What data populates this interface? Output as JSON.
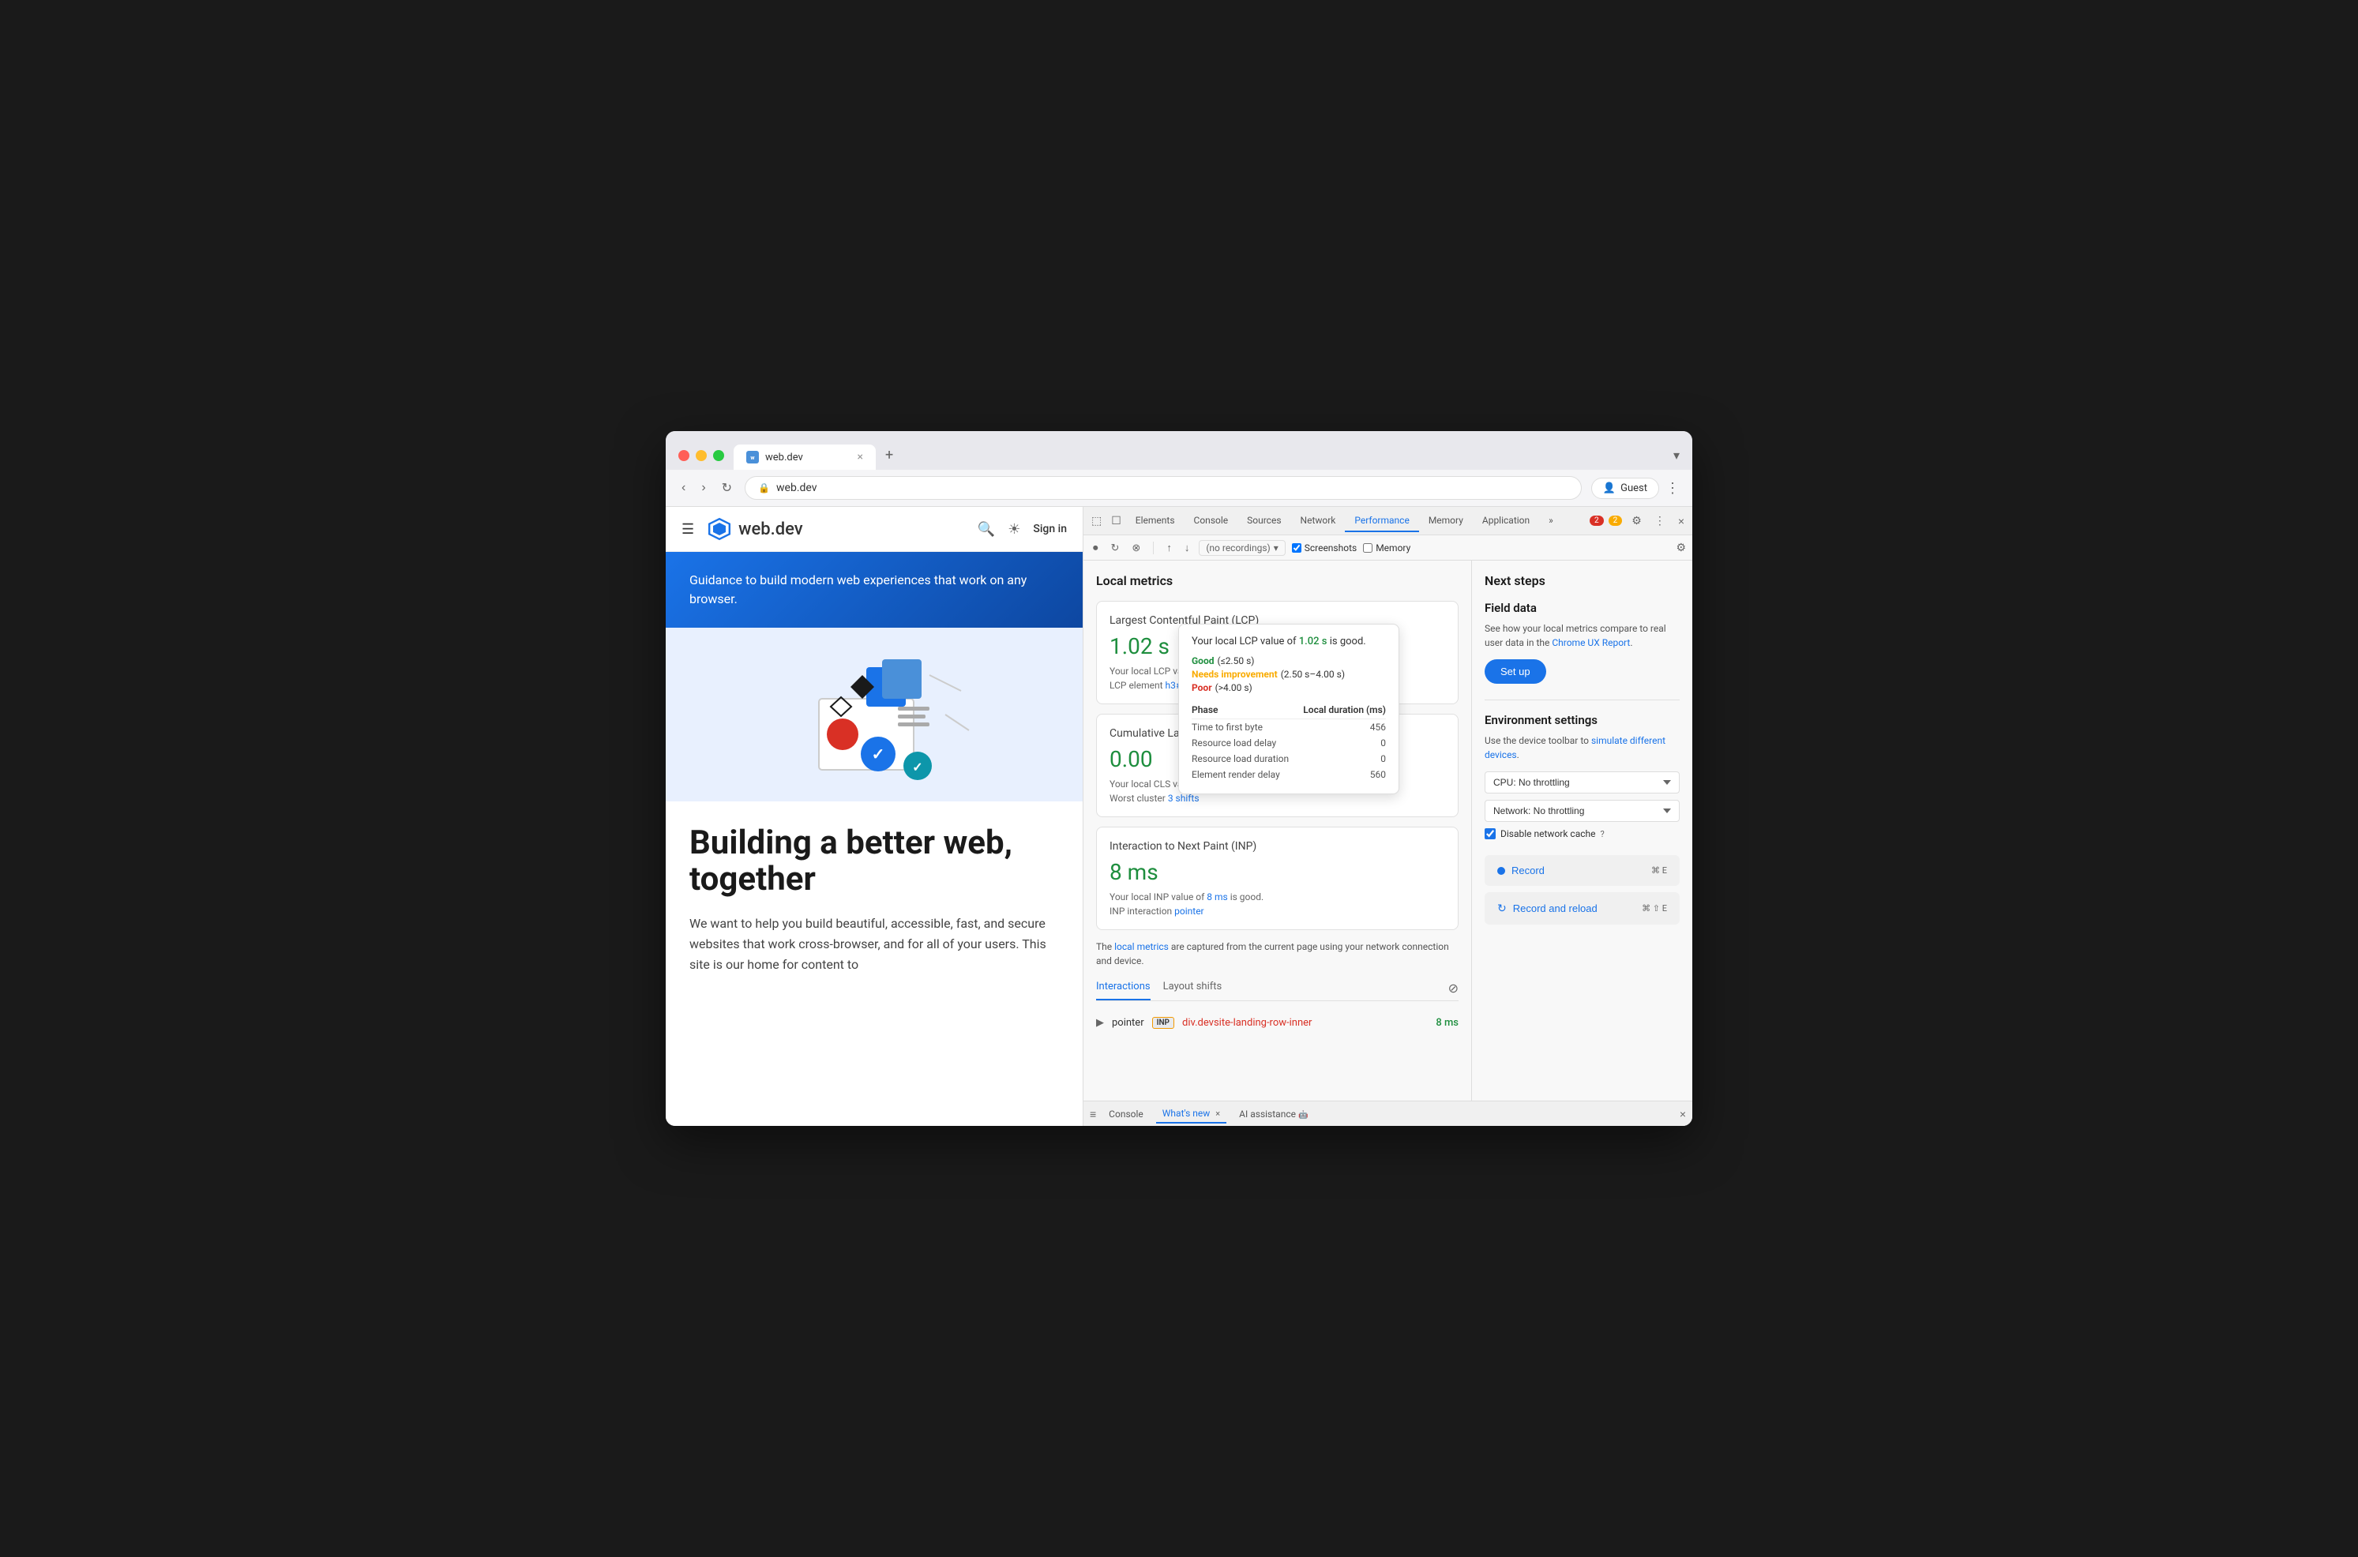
{
  "browser": {
    "traffic_lights": [
      "red",
      "yellow",
      "green"
    ],
    "tab_favicon": "web-dev-icon",
    "tab_title": "web.dev",
    "tab_close": "×",
    "tab_new": "+",
    "tab_menu_label": "▾",
    "address": "web.dev",
    "address_icon": "🔒",
    "guest_label": "Guest",
    "menu_icon": "⋮"
  },
  "webpage": {
    "hamburger": "☰",
    "logo_text": "web.dev",
    "search_icon": "search",
    "theme_icon": "theme",
    "signin_label": "Sign in",
    "hero_text": "Guidance to build modern web experiences that work on any browser.",
    "headline": "Building a better web, together",
    "subtext": "We want to help you build beautiful, accessible, fast, and secure websites that work cross-browser, and for all of your users. This site is our home for content to"
  },
  "devtools": {
    "tabs": [
      {
        "label": "Elements",
        "active": false
      },
      {
        "label": "Console",
        "active": false
      },
      {
        "label": "Sources",
        "active": false
      },
      {
        "label": "Network",
        "active": false
      },
      {
        "label": "Performance",
        "active": true
      },
      {
        "label": "Memory",
        "active": false
      },
      {
        "label": "Application",
        "active": false
      }
    ],
    "more_tabs": "»",
    "error_badge": "2",
    "warning_badge": "2",
    "close_icon": "×",
    "settings_icon": "⚙",
    "more_icon": "⋮",
    "toolbar": {
      "record_icon": "⏺",
      "reload_icon": "↻",
      "clear_icon": "⊗",
      "upload_icon": "↑",
      "download_icon": "↓",
      "recording_placeholder": "(no recordings)",
      "dropdown_icon": "▾",
      "screenshot_label": "Screenshots",
      "memory_label": "Memory",
      "settings_icon": "⚙"
    },
    "section_title": "Local metrics",
    "metrics": [
      {
        "name": "Largest Contentful Paint (LCP)",
        "value": "1.02 s",
        "value_class": "good",
        "desc": "Your local LCP value of",
        "highlight": "1.02 s",
        "desc2": "is good.",
        "element_label": "LCP element",
        "element_value": "h3#"
      },
      {
        "name": "Cumulative Layout Shift (CLS)",
        "value": "0.00",
        "value_class": "zero",
        "desc": "Your local CLS value",
        "worst_label": "Worst cluster",
        "worst_link": "3 shifts"
      },
      {
        "name": "Interaction to Next Paint (INP)",
        "value": "8 ms",
        "value_class": "good",
        "desc": "Your local INP value of",
        "highlight": "8 ms",
        "desc2": "is good.",
        "interaction_label": "INP interaction",
        "interaction_link": "pointer"
      }
    ],
    "local_metrics_note": "The local metrics are captured from the current page using your network connection and device.",
    "local_metrics_link": "local metrics",
    "interactions_tabs": [
      {
        "label": "Interactions",
        "active": true
      },
      {
        "label": "Layout shifts",
        "active": false
      }
    ],
    "interactions_filter_icon": "⊘",
    "interaction_rows": [
      {
        "arrow": "▶",
        "type": "pointer",
        "badge": "INP",
        "element": "div.devsite-landing-row-inner",
        "time": "8 ms"
      }
    ],
    "tooltip": {
      "main": "Your local LCP value of 1.02 s is good.",
      "lcp_value": "1.02 s",
      "ratings": [
        {
          "label": "Good (≤2.50 s)",
          "status": "good"
        },
        {
          "label": "Needs improvement (2.50 s–4.00 s)",
          "status": "needs"
        },
        {
          "label": "Poor (>4.00 s)",
          "status": "poor"
        }
      ],
      "phases_header_phase": "Phase",
      "phases_header_duration": "Local duration (ms)",
      "phases": [
        {
          "name": "Time to first byte",
          "value": "456"
        },
        {
          "name": "Resource load delay",
          "value": "0"
        },
        {
          "name": "Resource load duration",
          "value": "0"
        },
        {
          "name": "Element render delay",
          "value": "560"
        }
      ]
    },
    "sidebar": {
      "next_steps_title": "Next steps",
      "field_data_title": "Field data",
      "field_data_desc": "See how your local metrics compare to real user data in the",
      "field_data_link_text": "Chrome UX Report",
      "field_data_link": "#",
      "setup_label": "Set up",
      "env_title": "Environment settings",
      "env_desc": "Use the device toolbar to",
      "env_link_text": "simulate different devices",
      "env_link": "#",
      "cpu_label": "CPU: No throttling",
      "network_label": "Network: No throttling",
      "disable_cache_label": "Disable network cache",
      "help_icon": "?",
      "record_label": "Record",
      "record_shortcut": "⌘ E",
      "reload_label": "Record and reload",
      "reload_shortcut": "⌘ ⇧ E"
    }
  },
  "bottom_bar": {
    "menu_icon": "≡",
    "tabs": [
      {
        "label": "Console",
        "active": false
      },
      {
        "label": "What's new",
        "active": true,
        "closeable": true
      },
      {
        "label": "AI assistance",
        "active": false,
        "has_icon": true
      }
    ],
    "close_icon": "×"
  }
}
